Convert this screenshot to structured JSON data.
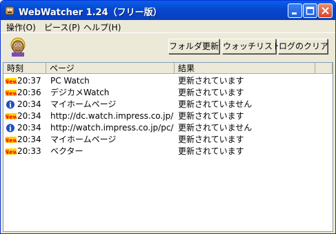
{
  "window": {
    "title": "WebWatcher 1.24（フリー版）"
  },
  "menu": {
    "items": [
      "操作(O)",
      "ピース(P)",
      "ヘルプ(H)"
    ]
  },
  "toolbar": {
    "folder_update_label": "フォルダ更新",
    "watch_list_label": "ウォッチリスト",
    "clear_log_label": "ログのクリア"
  },
  "list": {
    "columns": [
      "時刻",
      "ページ",
      "結果"
    ],
    "rows": [
      {
        "icon": "new-icon",
        "icon_text": "New",
        "time": "20:37",
        "page": "PC Watch",
        "result": "更新されています"
      },
      {
        "icon": "new-icon",
        "icon_text": "New",
        "time": "20:36",
        "page": "デジカメWatch",
        "result": "更新されています"
      },
      {
        "icon": "info-icon",
        "icon_text": "i",
        "time": "20:34",
        "page": "マイホームページ",
        "result": "更新されていません"
      },
      {
        "icon": "new-icon",
        "icon_text": "New",
        "time": "20:34",
        "page": "http://dc.watch.impress.co.jp/",
        "result": "更新されています"
      },
      {
        "icon": "info-icon",
        "icon_text": "i",
        "time": "20:34",
        "page": "http://watch.impress.co.jp/pc/",
        "result": "更新されていません"
      },
      {
        "icon": "new-icon",
        "icon_text": "New",
        "time": "20:34",
        "page": "マイホームページ",
        "result": "更新されています"
      },
      {
        "icon": "new-icon",
        "icon_text": "New",
        "time": "20:33",
        "page": "ベクター",
        "result": "更新されています"
      }
    ]
  },
  "colors": {
    "titlebar": "#0548d0",
    "face": "#ece9d8",
    "new_badge": "#ff0000",
    "info_badge": "#1f4fbf"
  }
}
